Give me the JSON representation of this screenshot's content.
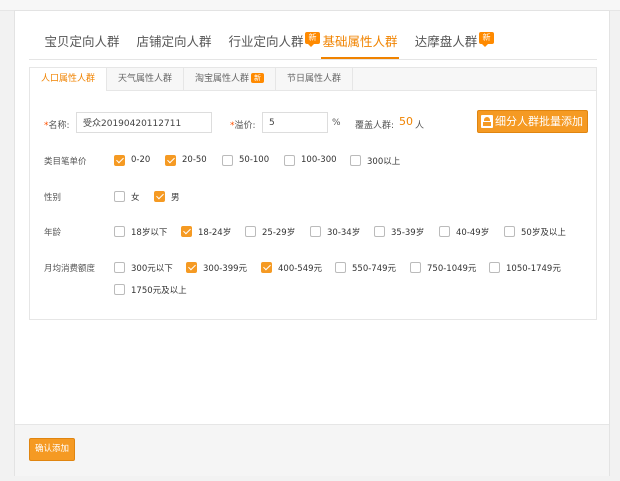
{
  "main_tabs": [
    {
      "label": "宝贝定向人群",
      "badge": ""
    },
    {
      "label": "店铺定向人群",
      "badge": ""
    },
    {
      "label": "行业定向人群",
      "badge": "新"
    },
    {
      "label": "基础属性人群",
      "badge": ""
    },
    {
      "label": "达摩盘人群",
      "badge": "新"
    }
  ],
  "active_main_tab": "基础属性人群",
  "sub_tabs": [
    {
      "label": "人口属性人群",
      "badge": ""
    },
    {
      "label": "天气属性人群",
      "badge": ""
    },
    {
      "label": "淘宝属性人群",
      "badge": "新"
    },
    {
      "label": "节日属性人群",
      "badge": ""
    }
  ],
  "active_sub_tab": "人口属性人群",
  "form": {
    "required_mark": "*",
    "name_label": "名称:",
    "name_value": "受众20190420112711",
    "premium_label": "溢价:",
    "premium_value": "5",
    "premium_unit": "%",
    "coverage_label": "覆盖人群:",
    "coverage_value": "50",
    "coverage_unit": "人",
    "batch_button": "细分人群批量添加"
  },
  "rows": [
    {
      "label": "类目笔单价",
      "options": [
        {
          "text": "0-20",
          "checked": true
        },
        {
          "text": "20-50",
          "checked": true
        },
        {
          "text": "50-100",
          "checked": false
        },
        {
          "text": "100-300",
          "checked": false
        },
        {
          "text": "300以上",
          "checked": false
        }
      ]
    },
    {
      "label": "性别",
      "options": [
        {
          "text": "女",
          "checked": false
        },
        {
          "text": "男",
          "checked": true
        }
      ]
    },
    {
      "label": "年龄",
      "options": [
        {
          "text": "18岁以下",
          "checked": false
        },
        {
          "text": "18-24岁",
          "checked": true
        },
        {
          "text": "25-29岁",
          "checked": false
        },
        {
          "text": "30-34岁",
          "checked": false
        },
        {
          "text": "35-39岁",
          "checked": false
        },
        {
          "text": "40-49岁",
          "checked": false
        },
        {
          "text": "50岁及以上",
          "checked": false
        }
      ]
    },
    {
      "label": "月均消费额度",
      "options": [
        {
          "text": "300元以下",
          "checked": false
        },
        {
          "text": "300-399元",
          "checked": true
        },
        {
          "text": "400-549元",
          "checked": true
        },
        {
          "text": "550-749元",
          "checked": false
        },
        {
          "text": "750-1049元",
          "checked": false
        },
        {
          "text": "1050-1749元",
          "checked": false
        },
        {
          "text": "1750元及以上",
          "checked": false
        }
      ]
    }
  ],
  "footer": {
    "confirm_button": "确认添加"
  },
  "colors": {
    "accent": "#f59a23",
    "active_tab": "#f08300"
  }
}
